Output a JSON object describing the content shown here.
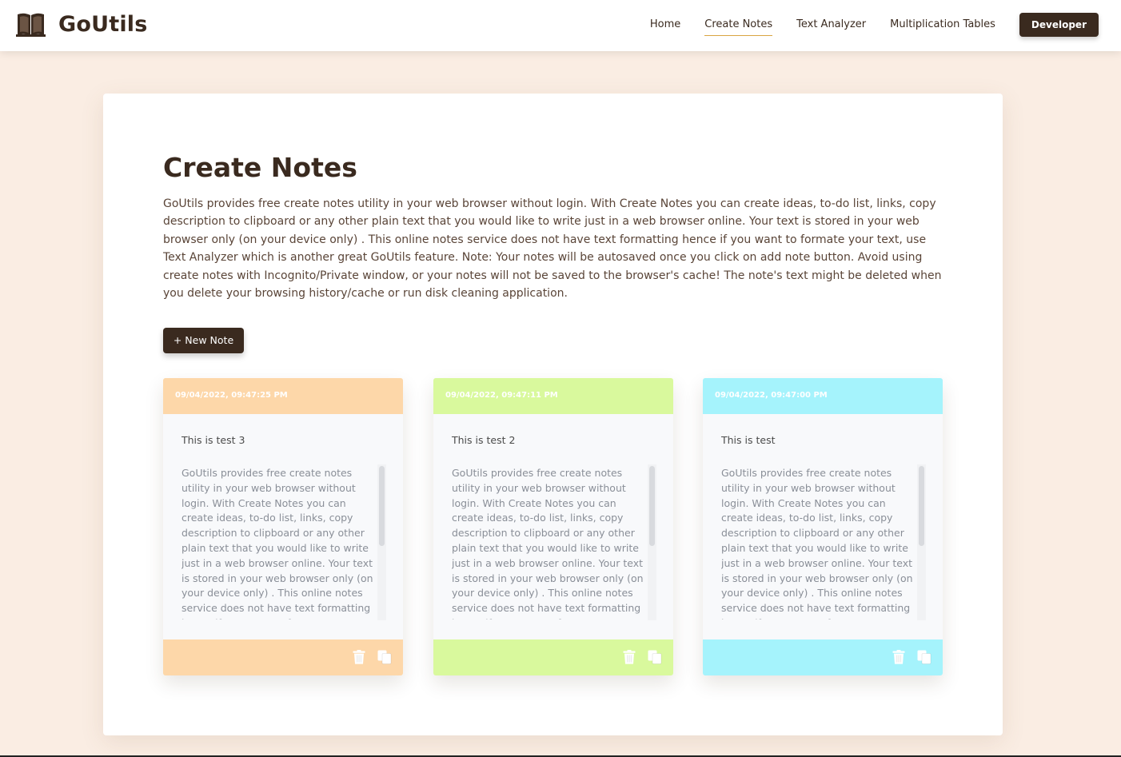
{
  "nav": {
    "brand": "GoUtils",
    "links": [
      "Home",
      "Create Notes",
      "Text Analyzer",
      "Multiplication Tables"
    ],
    "developer": "Developer"
  },
  "main": {
    "title": "Create Notes",
    "intro": "GoUtils provides free create notes utility in your web browser without login. With Create Notes you can create ideas, to-do list, links, copy description to clipboard or any other plain text that you would like to write just in a web browser online. Your text is stored in your web browser only (on your device only) . This online notes service does not have text formatting hence if you want to formate your text, use Text Analyzer which is another great GoUtils feature. Note: Your notes will be autosaved once you click on add note button. Avoid using create notes with Incognito/Private window, or your notes will not be saved to the browser's cache! The note's text might be deleted when you delete your browsing history/cache or run disk cleaning application.",
    "new_note": "+ New Note"
  },
  "notes": [
    {
      "timestamp": "09/04/2022, 09:47:25 PM",
      "title": "This is test 3",
      "body": "GoUtils provides free create notes utility in your web browser without login. With Create Notes you can create ideas, to-do list, links, copy description to clipboard or any other plain text that you would like to write just in a web browser online. Your text is stored in your web browser only (on your device only) . This online notes service does not have text formatting hence if you want to formate your text, use Text Analyzer which is another great GoUtils feature.",
      "color": "#fdd7a9",
      "actions": [
        "trash-icon",
        "copy-icon"
      ]
    },
    {
      "timestamp": "09/04/2022, 09:47:11 PM",
      "title": "This is test 2",
      "body": "GoUtils provides free create notes utility in your web browser without login. With Create Notes you can create ideas, to-do list, links, copy description to clipboard or any other plain text that you would like to write just in a web browser online. Your text is stored in your web browser only (on your device only) . This online notes service does not have text formatting hence if you want to formate your text, use Text Analyzer which is another great GoUtils feature.",
      "color": "#d9f99d",
      "actions": [
        "trash-icon",
        "copy-icon"
      ]
    },
    {
      "timestamp": "09/04/2022, 09:47:00 PM",
      "title": "This is test",
      "body": "GoUtils provides free create notes utility in your web browser without login. With Create Notes you can create ideas, to-do list, links, copy description to clipboard or any other plain text that you would like to write just in a web browser online. Your text is stored in your web browser only (on your device only) . This online notes service does not have text formatting hence if you want to formate your text, use Text Analyzer which is another great GoUtils feature.",
      "color": "#a5f3fc",
      "actions": [
        "trash-icon",
        "copy-icon"
      ]
    }
  ],
  "colors": {
    "brand_dark": "#3a2a1f",
    "page_bg": "#faede3",
    "active_underline": "#d9a441"
  }
}
